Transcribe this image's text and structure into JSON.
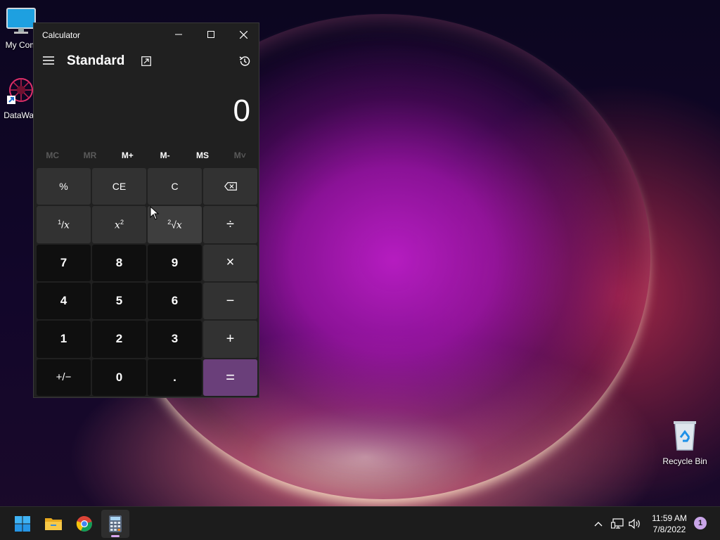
{
  "desktop": {
    "icons": [
      {
        "label": "My Com"
      },
      {
        "label": "DataWag"
      },
      {
        "label": "Recycle Bin"
      }
    ]
  },
  "calculator": {
    "window_title": "Calculator",
    "mode": "Standard",
    "display_value": "0",
    "memory_buttons": [
      "MC",
      "MR",
      "M+",
      "M-",
      "MS",
      "M˅"
    ],
    "keys": {
      "percent": "%",
      "ce": "CE",
      "c": "C",
      "divide": "÷",
      "multiply": "×",
      "subtract": "−",
      "add": "+",
      "equals": "=",
      "seven": "7",
      "eight": "8",
      "nine": "9",
      "four": "4",
      "five": "5",
      "six": "6",
      "one": "1",
      "two": "2",
      "three": "3",
      "negate": "+/−",
      "zero": "0",
      "decimal": "."
    }
  },
  "taskbar": {
    "time": "11:59 AM",
    "date": "7/8/2022",
    "notification_count": "1"
  },
  "colors": {
    "accent_equals": "#6a3f7a",
    "calc_bg": "#202020",
    "taskbar_bg": "#1c1c1c"
  }
}
